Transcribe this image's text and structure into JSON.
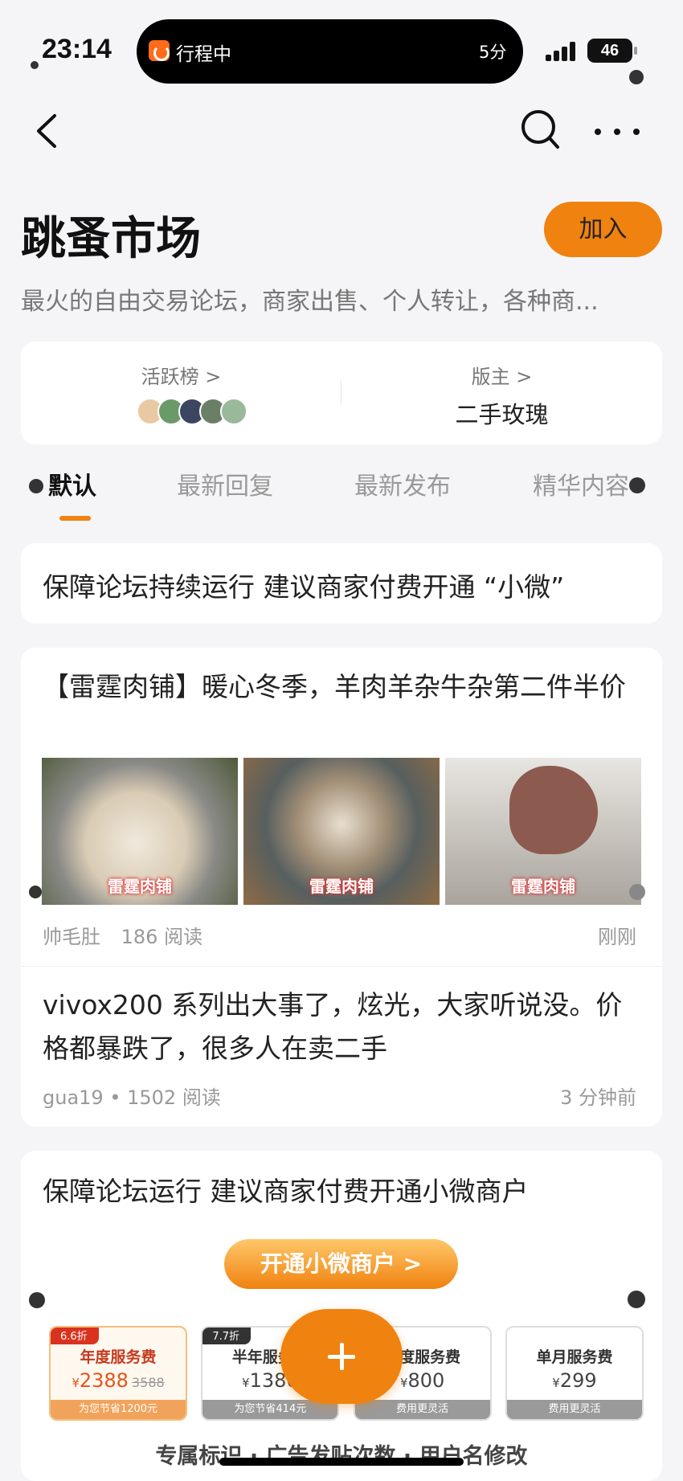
{
  "status_bar": {
    "time": "23:14",
    "activity_label": "行程中",
    "activity_time": "5分",
    "battery": "46"
  },
  "nav": {
    "back_icon": "chevron-left-icon",
    "search_icon": "search-icon",
    "more_icon": "more-icon"
  },
  "forum": {
    "title": "跳蚤市场",
    "join_label": "加入",
    "description": "最火的自由交易论坛，商家出售、个人转让，各种商..."
  },
  "info": {
    "active_label": "活跃榜 >",
    "moderator_label": "版主 >",
    "moderator_name": "二手玫瑰"
  },
  "tabs": [
    "默认",
    "最新回复",
    "最新发布",
    "精华内容"
  ],
  "posts": {
    "notice_1": "保障论坛持续运行 建议商家付费开通 “小微”",
    "post_1": {
      "title": "【雷霆肉铺】暖心冬季，羊肉羊杂牛杂第二件半价",
      "image_caption": "雷霆肉铺",
      "author": "帅毛肚",
      "reads": "186 阅读",
      "time": "刚刚"
    },
    "post_2": {
      "title": "vivox200 系列出大事了，炫光，大家听说没。价格都暴跌了，很多人在卖二手",
      "meta": "gua19 • 1502 阅读",
      "time": "3 分钟前"
    },
    "notice_2": {
      "title": "保障论坛运行 建议商家付费开通小微商户",
      "promo_button": "开通小微商户 >",
      "plans": [
        {
          "badge": "6.6折",
          "name": "年度服务费",
          "currency": "¥",
          "price": "2388",
          "original": "3588",
          "foot": "为您节省1200元"
        },
        {
          "badge": "7.7折",
          "name": "半年服务费",
          "currency": "¥",
          "price": "1380",
          "original": "",
          "foot": "为您节省414元"
        },
        {
          "badge": "",
          "name": "季度服务费",
          "currency": "¥",
          "price": "800",
          "original": "",
          "foot": "费用更灵活"
        },
        {
          "badge": "",
          "name": "单月服务费",
          "currency": "¥",
          "price": "299",
          "original": "",
          "foot": "费用更灵活"
        }
      ],
      "footer": "专属标识 · 广告发贴次数 · 用户名修改"
    }
  },
  "fab_icon": "plus-icon",
  "colors": {
    "accent": "#f0820f",
    "background": "#f5f5f7",
    "card": "#ffffff"
  }
}
